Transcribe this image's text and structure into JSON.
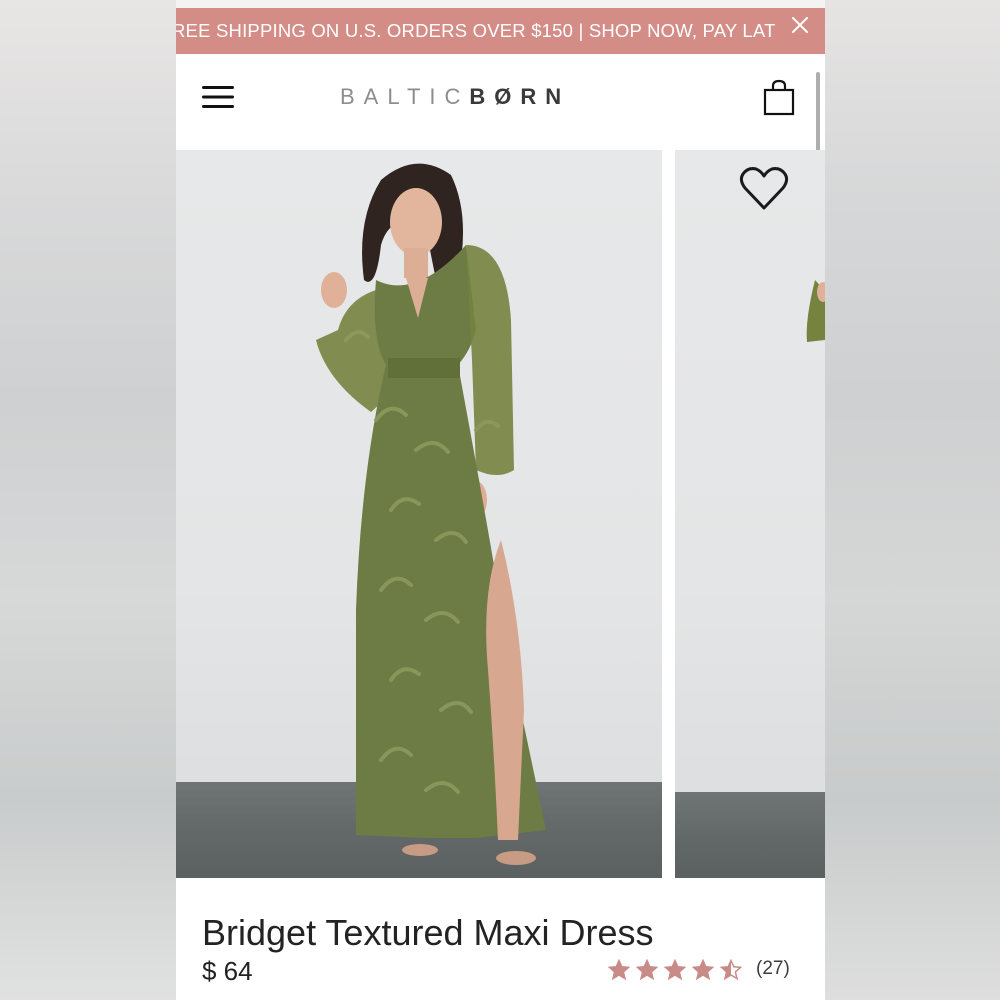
{
  "promo": {
    "text": "REE SHIPPING ON U.S. ORDERS OVER $150 | SHOP NOW, PAY LAT",
    "close_icon": "close-icon"
  },
  "header": {
    "menu_icon": "hamburger-menu-icon",
    "logo_part1": "BALTIC",
    "logo_part2": "BØRN",
    "bag_icon": "shopping-bag-icon"
  },
  "gallery": {
    "wishlist_icon": "heart-icon"
  },
  "product": {
    "title": "Bridget Textured Maxi Dress",
    "price": "$ 64",
    "rating": 4.5,
    "rating_max": 5,
    "review_count": "(27)"
  },
  "colors": {
    "promo_bg": "#d48c86",
    "star": "#c98b87",
    "text": "#232323",
    "dress": "#6d7b44"
  }
}
